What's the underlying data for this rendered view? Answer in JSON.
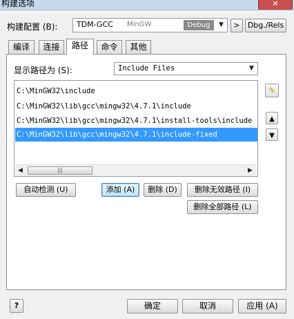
{
  "window": {
    "title": "构建选项",
    "close_label": "✕"
  },
  "build_config": {
    "label": "构建配置 (B):",
    "compiler": "TDM-GCC",
    "toolchain": "MinGW",
    "mode": "Debug",
    "next_label": ">",
    "target_label": "Dbg./Rels"
  },
  "tabs": [
    {
      "label": "编译"
    },
    {
      "label": "连接"
    },
    {
      "label": "路径"
    },
    {
      "label": "命令"
    },
    {
      "label": "其他"
    }
  ],
  "paths": {
    "label": "显示路径为 (S):",
    "selected_type": "Include Files",
    "items": [
      "C:\\MinGW32\\include",
      "C:\\MinGW32\\lib\\gcc\\mingw32\\4.7.1\\include",
      "C:\\MinGW32\\lib\\gcc\\mingw32\\4.7.1\\install-tools\\include",
      "C:\\MinGW32\\lib\\gcc\\mingw32\\4.7.1\\include-fixed"
    ],
    "selected_index": 3
  },
  "actions": {
    "auto_detect": "自动检测 (U)",
    "add": "添加 (A)",
    "delete": "删除 (D)",
    "delete_invalid": "删除无效路径 (I)",
    "delete_all": "删除全部路径 (L)"
  },
  "footer": {
    "help": "?",
    "ok": "确定",
    "cancel": "取消",
    "apply": "应用 (A)"
  }
}
